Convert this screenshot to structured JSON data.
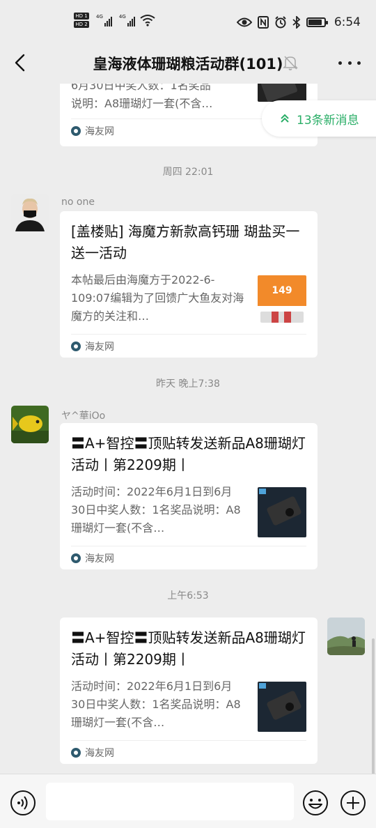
{
  "status_bar": {
    "hd1": "HD 1",
    "hd2": "HD 2",
    "net1": "4G",
    "net2": "4G",
    "wifi_label": "6",
    "time": "6:54",
    "battery_level": 0.85
  },
  "header": {
    "title": "皇海液体珊瑚粮活动群(101)"
  },
  "new_messages": {
    "label": "13条新消息"
  },
  "messages": {
    "top": {
      "desc1": "6月30日中奖人数：1名奖品",
      "desc2": "说明：A8珊瑚灯一套(不含…",
      "source": "海友网"
    },
    "t1": "周四 22:01",
    "m1": {
      "sender": "no one",
      "title": "[盖楼贴] 海魔方新款高钙珊 瑚盐买一送一活动",
      "desc": "本帖最后由海魔方于2022-6-109:07编辑为了回馈广大鱼友对海魔方的关注和…",
      "thumb_price": "149",
      "source": "海友网"
    },
    "t2": "昨天 晚上7:38",
    "m2": {
      "sender": "ヤ^華iOo",
      "title": "〓A+智控〓顶贴转发送新品A8珊瑚灯活动丨第2209期丨",
      "desc": "活动时间：2022年6月1日到6月30日中奖人数：1名奖品说明：A8珊瑚灯一套(不含…",
      "source": "海友网"
    },
    "t3": "上午6:53",
    "m3": {
      "title": "〓A+智控〓顶贴转发送新品A8珊瑚灯活动丨第2209期丨",
      "desc": "活动时间：2022年6月1日到6月30日中奖人数：1名奖品说明：A8珊瑚灯一套(不含…",
      "source": "海友网"
    }
  },
  "input": {
    "value": ""
  },
  "colors": {
    "accent_green": "#2aae67",
    "background": "#ededed",
    "card": "#ffffff"
  },
  "icons": [
    "back-arrow-icon",
    "mute-bell-icon",
    "more-icon",
    "voice-icon",
    "emoji-icon",
    "plus-icon",
    "source-logo-icon",
    "double-chevron-up-icon"
  ]
}
